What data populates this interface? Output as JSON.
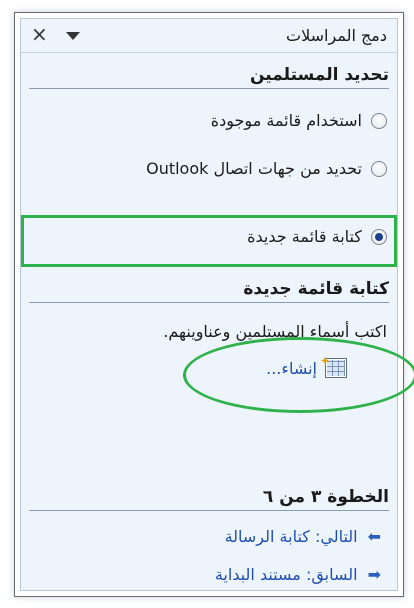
{
  "pane": {
    "title": "دمج المراسلات",
    "close_glyph": "×"
  },
  "recipients": {
    "heading": "تحديد المستلمين",
    "options": [
      {
        "label": "استخدام قائمة موجودة",
        "checked": false
      },
      {
        "label": "تحديد من جهات اتصال Outlook",
        "checked": false
      },
      {
        "label": "كتابة قائمة جديدة",
        "checked": true
      }
    ]
  },
  "new_list": {
    "heading": "كتابة قائمة جديدة",
    "description": "اكتب أسماء المستلمين وعناوينهم.",
    "create_label": "إنشاء..."
  },
  "step": {
    "heading": "الخطوة ٣ من ٦",
    "next_label": "التالي: كتابة الرسالة",
    "prev_label": "السابق: مستند البداية"
  },
  "colors": {
    "accent_link": "#1f4fb0",
    "highlight_green": "#2fb14b",
    "pane_bg": "#eef4fb"
  },
  "icons": {
    "close": "close-icon",
    "menu": "chevron-down-icon",
    "create": "table-icon",
    "next": "arrow-left-icon",
    "prev": "arrow-right-icon"
  }
}
